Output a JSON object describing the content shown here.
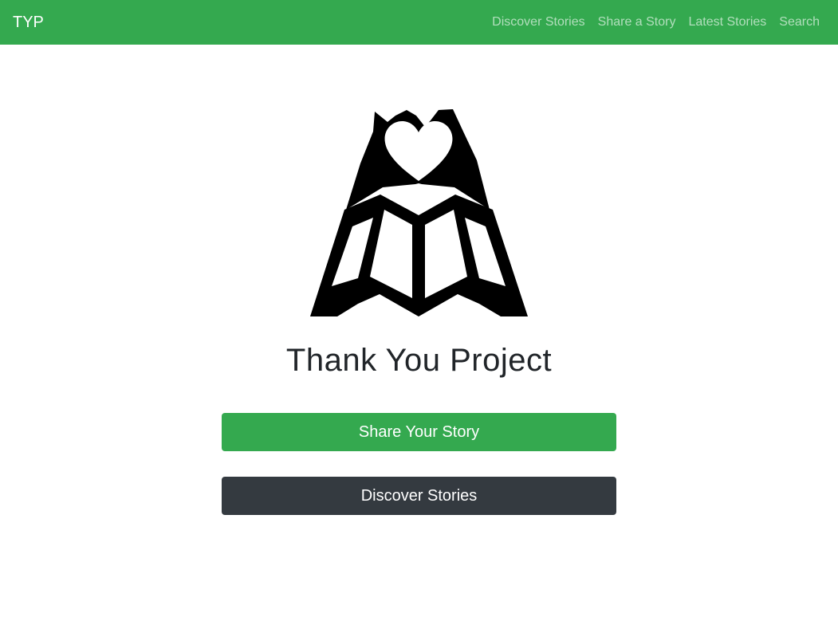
{
  "navbar": {
    "brand": "TYP",
    "links": [
      {
        "label": "Discover Stories"
      },
      {
        "label": "Share a Story"
      },
      {
        "label": "Latest Stories"
      },
      {
        "label": "Search"
      }
    ]
  },
  "main": {
    "logo_icon": "hands-heart-book-icon",
    "title": "Thank You Project",
    "buttons": {
      "share_label": "Share Your Story",
      "discover_label": "Discover Stories"
    }
  },
  "colors": {
    "brand_green": "#34a94f",
    "dark_button": "#343a40",
    "text": "#212529"
  }
}
